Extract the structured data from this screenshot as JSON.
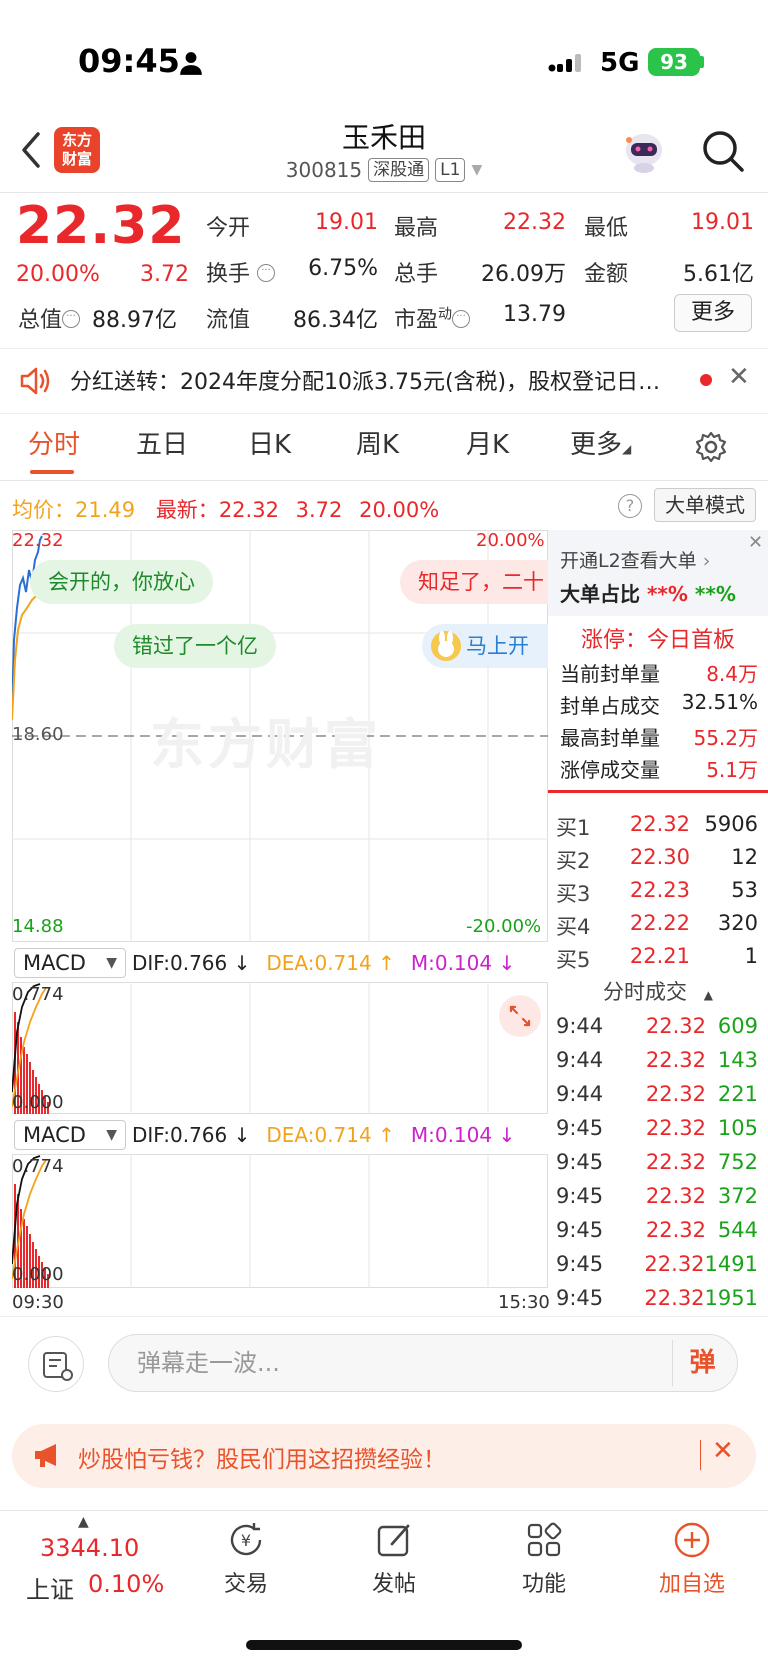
{
  "status_bar": {
    "time": "09:45",
    "network": "5G",
    "battery": "93"
  },
  "header": {
    "logo_text_1": "东方",
    "logo_text_2": "财富",
    "stock_name": "玉禾田",
    "stock_code": "300815",
    "tag_1": "深股通",
    "tag_2": "L1"
  },
  "quote": {
    "price": "22.32",
    "change_pct": "20.00%",
    "change": "3.72",
    "fields": [
      {
        "label": "今开",
        "value": "19.01",
        "color": "red"
      },
      {
        "label": "最高",
        "value": "22.32",
        "color": "red"
      },
      {
        "label": "最低",
        "value": "19.01",
        "color": "red"
      },
      {
        "label": "换手",
        "value": "6.75%",
        "color": "black"
      },
      {
        "label": "总手",
        "value": "26.09万",
        "color": "black"
      },
      {
        "label": "金额",
        "value": "5.61亿",
        "color": "black"
      },
      {
        "label": "总值",
        "value": "88.97亿",
        "color": "black"
      },
      {
        "label": "流值",
        "value": "86.34亿",
        "color": "black"
      },
      {
        "label": "市盈",
        "label_sup": "动",
        "value": "13.79",
        "color": "black"
      }
    ],
    "more_label": "更多"
  },
  "notice": {
    "text": "分红送转：2024年度分配10派3.75元(含税)，股权登记日…"
  },
  "tabs": [
    "分时",
    "五日",
    "日K",
    "周K",
    "月K",
    "更多"
  ],
  "chart_header": {
    "avg_label": "均价：",
    "avg_value": "21.49",
    "latest_label": "最新：",
    "latest_value": "22.32",
    "chg": "3.72",
    "pct": "20.00%",
    "mode_btn": "大单模式",
    "help": "?"
  },
  "chart": {
    "y_top": "22.32",
    "y_mid": "18.60",
    "y_bot": "14.88",
    "pct_top": "20.00%",
    "pct_bot": "-20.00%",
    "watermark": "东方财富",
    "x_start": "09:30",
    "x_end": "15:30"
  },
  "danmu": [
    {
      "text": "会开的，你放心",
      "style": "g"
    },
    {
      "text": "错过了一个亿",
      "style": "g"
    },
    {
      "text": "知足了，二十",
      "style": "r"
    },
    {
      "text": "马上开",
      "style": "b"
    }
  ],
  "macd": {
    "name": "MACD",
    "dif": "DIF:0.766 ↓",
    "dea": "DEA:0.714 ↑",
    "m": "M:0.104 ↓",
    "y_top": "0.774",
    "y_bot": "0.000"
  },
  "right_panel": {
    "l2_line": "开通L2查看大单",
    "ratio_label": "大单占比",
    "ratio_v1": "**%",
    "ratio_v2": "**%",
    "limit_title": "涨停：今日首板",
    "kv": [
      {
        "k": "当前封单量",
        "v": "8.4万",
        "c": "red"
      },
      {
        "k": "封单占成交",
        "v": "32.51%",
        "c": "black"
      },
      {
        "k": "最高封单量",
        "v": "55.2万",
        "c": "red"
      },
      {
        "k": "涨停成交量",
        "v": "5.1万",
        "c": "red"
      }
    ],
    "bids": [
      {
        "l": "买1",
        "p": "22.32",
        "v": "5906"
      },
      {
        "l": "买2",
        "p": "22.30",
        "v": "12"
      },
      {
        "l": "买3",
        "p": "22.23",
        "v": "53"
      },
      {
        "l": "买4",
        "p": "22.22",
        "v": "320"
      },
      {
        "l": "买5",
        "p": "22.21",
        "v": "1"
      }
    ],
    "ticks_title": "分时成交",
    "ticks": [
      {
        "t": "9:44",
        "p": "22.32",
        "v": "609"
      },
      {
        "t": "9:44",
        "p": "22.32",
        "v": "143"
      },
      {
        "t": "9:44",
        "p": "22.32",
        "v": "221"
      },
      {
        "t": "9:45",
        "p": "22.32",
        "v": "105"
      },
      {
        "t": "9:45",
        "p": "22.32",
        "v": "752"
      },
      {
        "t": "9:45",
        "p": "22.32",
        "v": "372"
      },
      {
        "t": "9:45",
        "p": "22.32",
        "v": "544"
      },
      {
        "t": "9:45",
        "p": "22.32",
        "v": "1491"
      },
      {
        "t": "9:45",
        "p": "22.32",
        "v": "1951"
      }
    ]
  },
  "comment": {
    "placeholder": "弹幕走一波...",
    "danmu_btn": "弹"
  },
  "ad": {
    "text": "炒股怕亏钱？股民们用这招攒经验！"
  },
  "bottom_nav": {
    "index_value": "3344.10",
    "index_name": "上证",
    "index_pct": "0.10%",
    "items": [
      "交易",
      "发帖",
      "功能",
      "加自选"
    ]
  },
  "colors": {
    "red": "#e8282b",
    "green": "#1aa31a",
    "accent": "#e8532b"
  }
}
